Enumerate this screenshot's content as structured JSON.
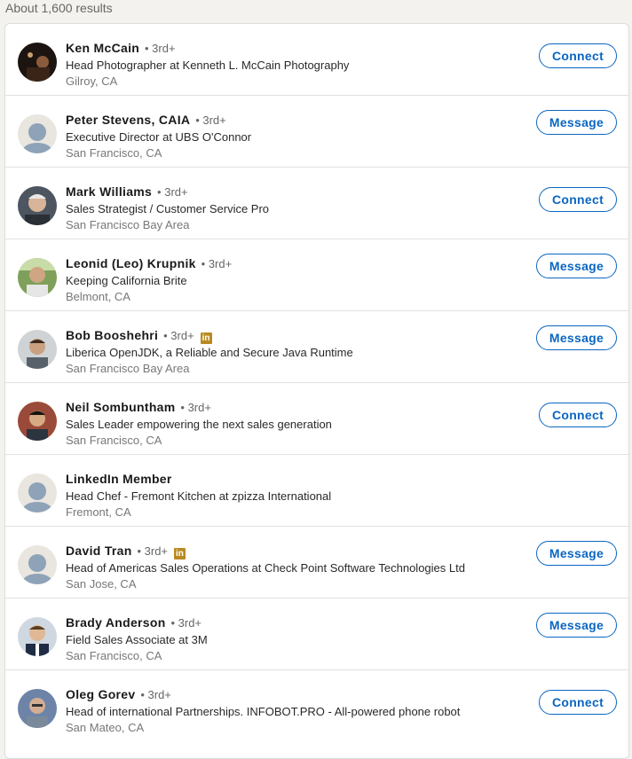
{
  "results_count": "About 1,600 results",
  "results": [
    {
      "name": "Ken McCain",
      "degree": "• 3rd+",
      "premium": false,
      "headline": "Head Photographer at Kenneth L. McCain Photography",
      "location": "Gilroy, CA",
      "action": "Connect",
      "avatar": "photo-dark"
    },
    {
      "name": "Peter Stevens, CAIA",
      "degree": "• 3rd+",
      "premium": false,
      "headline": "Executive Director at UBS O'Connor",
      "location": "San Francisco, CA",
      "action": "Message",
      "avatar": "placeholder"
    },
    {
      "name": "Mark Williams",
      "degree": "• 3rd+",
      "premium": false,
      "headline": "Sales Strategist / Customer Service Pro",
      "location": "San Francisco Bay Area",
      "action": "Connect",
      "avatar": "photo-grey"
    },
    {
      "name": "Leonid (Leo) Krupnik",
      "degree": "• 3rd+",
      "premium": false,
      "headline": "Keeping California Brite",
      "location": "Belmont, CA",
      "action": "Message",
      "avatar": "photo-green"
    },
    {
      "name": "Bob Booshehri",
      "degree": "• 3rd+",
      "premium": true,
      "headline": "Liberica OpenJDK, a Reliable and Secure Java Runtime",
      "location": "San Francisco Bay Area",
      "action": "Message",
      "avatar": "photo-light"
    },
    {
      "name": "Neil Sombuntham",
      "degree": "• 3rd+",
      "premium": false,
      "headline": "Sales Leader empowering the next sales generation",
      "location": "San Francisco, CA",
      "action": "Connect",
      "avatar": "photo-brick"
    },
    {
      "name": "LinkedIn Member",
      "degree": "",
      "premium": false,
      "headline": "Head Chef - Fremont Kitchen at zpizza International",
      "location": "Fremont, CA",
      "action": "",
      "avatar": "placeholder"
    },
    {
      "name": "David Tran",
      "degree": "• 3rd+",
      "premium": true,
      "headline": "Head of Americas Sales Operations at Check Point Software Technologies Ltd",
      "location": "San Jose, CA",
      "action": "Message",
      "avatar": "placeholder"
    },
    {
      "name": "Brady Anderson",
      "degree": "• 3rd+",
      "premium": false,
      "headline": "Field Sales Associate at 3M",
      "location": "San Francisco, CA",
      "action": "Message",
      "avatar": "photo-suit"
    },
    {
      "name": "Oleg Gorev",
      "degree": "• 3rd+",
      "premium": false,
      "headline": "Head of international Partnerships. INFOBOT.PRO - All-powered phone robot",
      "location": "San Mateo, CA",
      "action": "Connect",
      "avatar": "photo-blue"
    }
  ],
  "colors": {
    "accent": "#0a66c2",
    "premium_badge": "#b98a22"
  },
  "premium_badge_text": "in"
}
